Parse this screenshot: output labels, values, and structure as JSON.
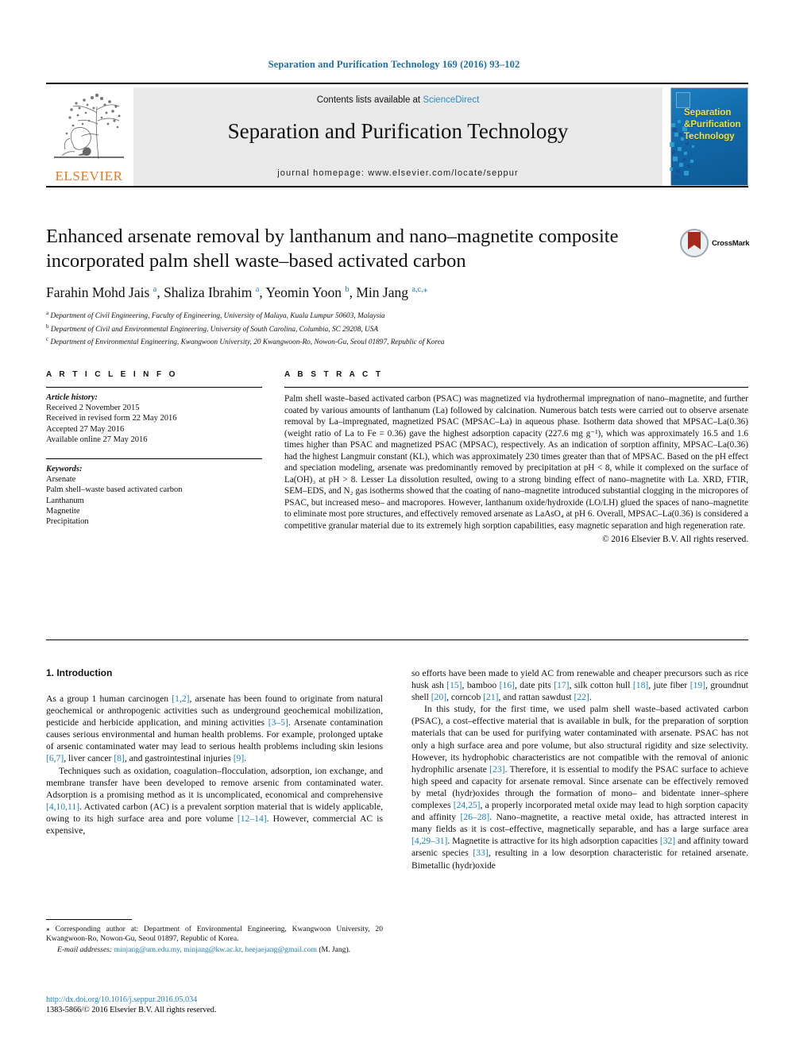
{
  "running_head": "Separation and Purification Technology 169 (2016) 93–102",
  "masthead": {
    "contents_prefix": "Contents lists available at ",
    "sciencedirect": "ScienceDirect",
    "journal_title": "Separation and Purification Technology",
    "homepage": "journal homepage: www.elsevier.com/locate/seppur",
    "publisher": "ELSEVIER",
    "cover_title_line1": "Separation",
    "cover_title_line2": "Purification",
    "cover_title_line3": "Technology",
    "cover_amp": "&"
  },
  "article": {
    "title": "Enhanced arsenate removal by lanthanum and nano–magnetite composite incorporated palm shell waste–based activated carbon",
    "crossmark_label": "CrossMark",
    "authors_html": "Farahin Mohd Jais <sup>a</sup>, Shaliza Ibrahim <sup>a</sup>, Yeomin Yoon <sup>b</sup>, Min Jang <sup>a,c,</sup><sup>⁎</sup>",
    "affiliations": [
      {
        "mark": "a",
        "text": "Department of Civil Engineering, Faculty of Engineering, University of Malaya, Kuala Lumpur 50603, Malaysia"
      },
      {
        "mark": "b",
        "text": "Department of Civil and Environmental Engineering, University of South Carolina, Columbia, SC 29208, USA"
      },
      {
        "mark": "c",
        "text": "Department of Environmental Engineering, Kwangwoon University, 20 Kwangwoon-Ro, Nowon-Gu, Seoul 01897, Republic of Korea"
      }
    ]
  },
  "article_info": {
    "heading": "A R T I C L E    I N F O",
    "history_label": "Article history:",
    "history": [
      "Received 2 November 2015",
      "Received in revised form 22 May 2016",
      "Accepted 27 May 2016",
      "Available online 27 May 2016"
    ],
    "keywords_label": "Keywords:",
    "keywords": [
      "Arsenate",
      "Palm shell–waste based activated carbon",
      "Lanthanum",
      "Magnetite",
      "Precipitation"
    ]
  },
  "abstract": {
    "heading": "A B S T R A C T",
    "text": "Palm shell waste–based activated carbon (PSAC) was magnetized via hydrothermal impregnation of nano–magnetite, and further coated by various amounts of lanthanum (La) followed by calcination. Numerous batch tests were carried out to observe arsenate removal by La–impregnated, magnetized PSAC (MPSAC–La) in aqueous phase. Isotherm data showed that MPSAC–La(0.36) (weight ratio of La to Fe = 0.36) gave the highest adsorption capacity (227.6 mg g⁻¹), which was approximately 16.5 and 1.6 times higher than PSAC and magnetized PSAC (MPSAC), respectively. As an indication of sorption affinity, MPSAC–La(0.36) had the highest Langmuir constant (KL), which was approximately 230 times greater than that of MPSAC. Based on the pH effect and speciation modeling, arsenate was predominantly removed by precipitation at pH < 8, while it complexed on the surface of La(OH)₃ at pH > 8. Lesser La dissolution resulted, owing to a strong binding effect of nano–magnetite with La. XRD, FTIR, SEM–EDS, and N₂ gas isotherms showed that the coating of nano–magnetite introduced substantial clogging in the micropores of PSAC, but increased meso– and macropores. However, lanthanum oxide/hydroxide (LO/LH) glued the spaces of nano–magnetite to eliminate most pore structures, and effectively removed arsenate as LaAsO₄ at pH 6. Overall, MPSAC–La(0.36) is considered a competitive granular material due to its extremely high sorption capabilities, easy magnetic separation and high regeneration rate.",
    "copyright": "© 2016 Elsevier B.V. All rights reserved."
  },
  "body": {
    "section1_heading": "1. Introduction",
    "left_paragraphs": [
      "As a group 1 human carcinogen [1,2], arsenate has been found to originate from natural geochemical or anthropogenic activities such as underground geochemical mobilization, pesticide and herbicide application, and mining activities [3–5]. Arsenate contamination causes serious environmental and human health problems. For example, prolonged uptake of arsenic contaminated water may lead to serious health problems including skin lesions [6,7], liver cancer [8], and gastrointestinal injuries [9].",
      "Techniques such as oxidation, coagulation–flocculation, adsorption, ion exchange, and membrane transfer have been developed to remove arsenic from contaminated water. Adsorption is a promising method as it is uncomplicated, economical and comprehensive [4,10,11]. Activated carbon (AC) is a prevalent sorption material that is widely applicable, owing to its high surface area and pore volume [12–14]. However, commercial AC is expensive,"
    ],
    "right_paragraphs": [
      "so efforts have been made to yield AC from renewable and cheaper precursors such as rice husk ash [15], bamboo [16], date pits [17], silk cotton hull [18], jute fiber [19], groundnut shell [20], corncob [21], and rattan sawdust [22].",
      "In this study, for the first time, we used palm shell waste–based activated carbon (PSAC), a cost–effective material that is available in bulk, for the preparation of sorption materials that can be used for purifying water contaminated with arsenate. PSAC has not only a high surface area and pore volume, but also structural rigidity and size selectivity. However, its hydrophobic characteristics are not compatible with the removal of anionic hydrophilic arsenate [23]. Therefore, it is essential to modify the PSAC surface to achieve high speed and capacity for arsenate removal. Since arsenate can be effectively removed by metal (hydr)oxides through the formation of mono– and bidentate inner–sphere complexes [24,25], a properly incorporated metal oxide may lead to high sorption capacity and affinity [26–28]. Nano–magnetite, a reactive metal oxide, has attracted interest in many fields as it is cost–effective, magnetically separable, and has a large surface area [4,29–31]. Magnetite is attractive for its high adsorption capacities [32] and affinity toward arsenic species [33], resulting in a low desorption characteristic for retained arsenate. Bimetallic (hydr)oxide"
    ]
  },
  "footnote": {
    "marker": "⁎",
    "corresponding": "Corresponding author at: Department of Environmental Engineering, Kwangwoon University, 20 Kwangwoon-Ro, Nowon-Gu, Seoul 01897, Republic of Korea.",
    "email_label": "E-mail addresses:",
    "emails": "minjang@um.edu.my, minjang@kw.ac.kr, heejaejang@gmail.com",
    "email_suffix": " (M. Jang)."
  },
  "doi": {
    "url": "http://dx.doi.org/10.1016/j.seppur.2016.05.034",
    "issn_line": "1383-5866/© 2016 Elsevier B.V. All rights reserved."
  },
  "colors": {
    "link": "#1f7fba",
    "elsevier_orange": "#E87722",
    "cover_blue": "#1169a8",
    "cover_yellow": "#f5e03a"
  }
}
